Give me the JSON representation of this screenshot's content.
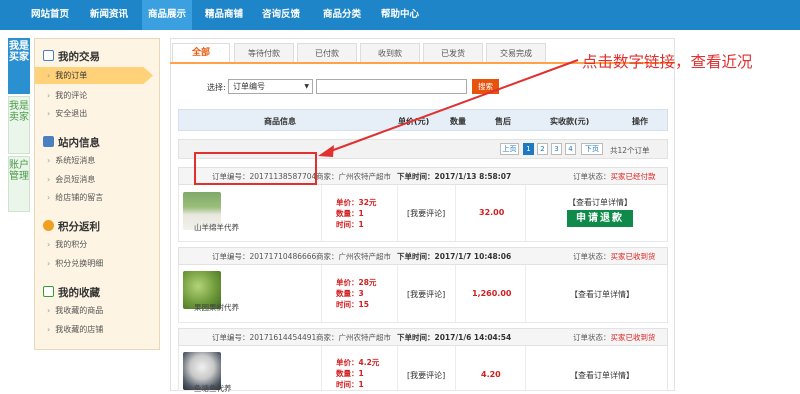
{
  "nav": {
    "items": [
      "网站首页",
      "新闻资讯",
      "商品展示",
      "精品商铺",
      "咨询反馈",
      "商品分类",
      "帮助中心"
    ]
  },
  "side_tabs": {
    "buyer": "我是买家",
    "seller": "我是卖家",
    "account": "账户管理"
  },
  "sidebar": {
    "sections": [
      {
        "title": "我的交易",
        "links": [
          "我的订单",
          "我的评论",
          "安全退出"
        ]
      },
      {
        "title": "站内信息",
        "links": [
          "系统短消息",
          "会员短消息",
          "给店铺的留言"
        ]
      },
      {
        "title": "积分返利",
        "links": [
          "我的积分",
          "积分兑换明细"
        ]
      },
      {
        "title": "我的收藏",
        "links": [
          "我收藏的商品",
          "我收藏的店铺"
        ]
      }
    ]
  },
  "tabs": [
    "全部",
    "等待付款",
    "已付款",
    "收到款",
    "已发货",
    "交易完成"
  ],
  "filter": {
    "label": "选择:",
    "select_value": "订单编号",
    "search_label": "搜索"
  },
  "table_header": [
    "商品信息",
    "单价(元)",
    "数量",
    "售后",
    "实收款(元)",
    "操作"
  ],
  "pager": {
    "prev": "上页",
    "pages": [
      "1",
      "2",
      "3",
      "4"
    ],
    "current": "1",
    "next": "下页",
    "total": "共12个订单"
  },
  "orders": [
    {
      "number_label": "订单编号：",
      "number": "20171138587704",
      "merchant": "商家：广州农特产超市",
      "time_label": "下单时间：",
      "time": "2017/1/13 8:58:07",
      "status_label": "订单状态：",
      "status": "买家已经付款",
      "product": "山羊绵羊代养",
      "price": "单价：32元",
      "qty": "数量：1",
      "duration": "时间：1",
      "review": "[我要评论]",
      "amount": "32.00",
      "detail": "【查看订单详情】",
      "refund": "申请退款"
    },
    {
      "number_label": "订单编号：",
      "number": "20171710486666",
      "merchant": "商家：广州农特产超市",
      "time_label": "下单时间：",
      "time": "2017/1/7 10:48:06",
      "status_label": "订单状态：",
      "status": "买家已收到货",
      "product": "果园果树代养",
      "price": "单价：28元",
      "qty": "数量：3",
      "duration": "时间：15",
      "review": "[我要评论]",
      "amount": "1,260.00",
      "detail": "【查看订单详情】"
    },
    {
      "number_label": "订单编号：",
      "number": "20171614454491",
      "merchant": "商家：广州农特产超市",
      "time_label": "下单时间：",
      "time": "2017/1/6 14:04:54",
      "status_label": "订单状态：",
      "status": "买家已收到货",
      "product": "鱼塘鱼代养",
      "price": "单价：4.2元",
      "qty": "数量：1",
      "duration": "时间：1",
      "review": "[我要评论]",
      "amount": "4.20",
      "detail": "【查看订单详情】"
    }
  ],
  "annotation": {
    "text": "点击数字链接，查看近况"
  },
  "colors": {
    "nav_bg": "#1e86c8",
    "accent_orange": "#e7520c",
    "status_red": "#e02020",
    "refund_green": "#0f8a4a",
    "annotation_red": "#e03030"
  }
}
